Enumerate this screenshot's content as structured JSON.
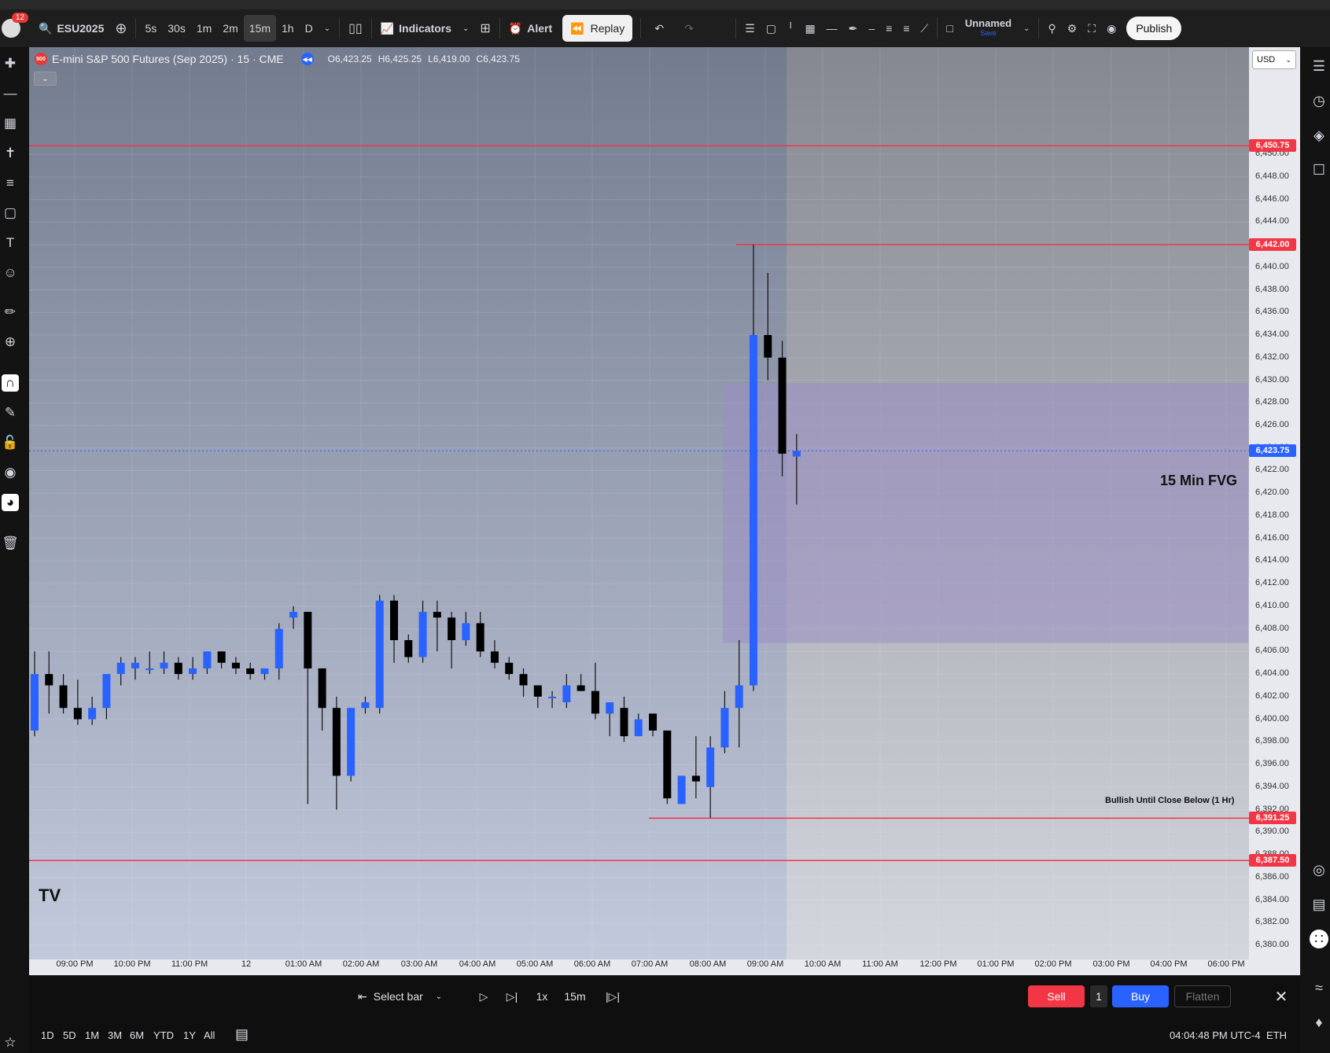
{
  "header": {
    "symbol": "ESU2025",
    "notification_count": "12",
    "intervals": [
      "5s",
      "30s",
      "1m",
      "2m",
      "15m",
      "1h",
      "D"
    ],
    "active_interval": "15m",
    "indicators_label": "Indicators",
    "alert_label": "Alert",
    "replay_label": "Replay",
    "layout_name": "Unnamed",
    "save_label": "Save",
    "publish_label": "Publish"
  },
  "legend": {
    "title": "E-mini S&P 500 Futures (Sep 2025) · 15 · CME",
    "logo_text": "500",
    "open": "O6,423.25",
    "high": "H6,425.25",
    "low": "L6,419.00",
    "close": "C6,423.75"
  },
  "currency": "USD",
  "price_axis": {
    "ticks": [
      "6,450.00",
      "6,448.00",
      "6,446.00",
      "6,444.00",
      "6,442.00",
      "6,440.00",
      "6,438.00",
      "6,436.00",
      "6,434.00",
      "6,432.00",
      "6,430.00",
      "6,428.00",
      "6,426.00",
      "6,424.00",
      "6,422.00",
      "6,420.00",
      "6,418.00",
      "6,416.00",
      "6,414.00",
      "6,412.00",
      "6,410.00",
      "6,408.00",
      "6,406.00",
      "6,404.00",
      "6,402.00",
      "6,400.00",
      "6,398.00",
      "6,396.00",
      "6,394.00",
      "6,392.00",
      "6,390.00",
      "6,388.00",
      "6,386.00",
      "6,384.00",
      "6,382.00",
      "6,380.00"
    ]
  },
  "time_axis": {
    "ticks": [
      "09:00 PM",
      "10:00 PM",
      "11:00 PM",
      "12",
      "01:00 AM",
      "02:00 AM",
      "03:00 AM",
      "04:00 AM",
      "05:00 AM",
      "06:00 AM",
      "07:00 AM",
      "08:00 AM",
      "09:00 AM",
      "10:00 AM",
      "11:00 AM",
      "12:00 PM",
      "01:00 PM",
      "02:00 PM",
      "03:00 PM",
      "04:00 PM",
      "06:00 PM"
    ]
  },
  "levels": [
    {
      "price": 6450.75,
      "label": "6,450.75",
      "color": "#f23645"
    },
    {
      "price": 6442.0,
      "label": "6,442.00",
      "color": "#f23645"
    },
    {
      "price": 6391.25,
      "label": "6,391.25",
      "color": "#f23645"
    },
    {
      "price": 6387.5,
      "label": "6,387.50",
      "color": "#f23645"
    },
    {
      "price": 6423.75,
      "label": "6,423.75",
      "color": "#2962ff"
    }
  ],
  "fvg": {
    "label": "15 Min FVG",
    "top": 6429.75,
    "bottom": 6406.75,
    "color": "#9b8ec4"
  },
  "support_note": "Bullish Until Close Below (1 Hr)",
  "chart_data": {
    "type": "candlestick",
    "interval": "15",
    "up_color": "#2962ff",
    "down_color": "#000000",
    "candles": [
      {
        "o": 6399,
        "h": 6406,
        "l": 6398.5,
        "c": 6404
      },
      {
        "o": 6404,
        "h": 6406,
        "l": 6400.5,
        "c": 6403
      },
      {
        "o": 6403,
        "h": 6404,
        "l": 6400.5,
        "c": 6401
      },
      {
        "o": 6401,
        "h": 6403.5,
        "l": 6399.5,
        "c": 6400
      },
      {
        "o": 6400,
        "h": 6402,
        "l": 6399.5,
        "c": 6401
      },
      {
        "o": 6401,
        "h": 6404,
        "l": 6400,
        "c": 6404
      },
      {
        "o": 6404,
        "h": 6405.5,
        "l": 6403,
        "c": 6405
      },
      {
        "o": 6404.5,
        "h": 6405.5,
        "l": 6403.5,
        "c": 6405
      },
      {
        "o": 6404.5,
        "h": 6406,
        "l": 6404,
        "c": 6404.5
      },
      {
        "o": 6404.5,
        "h": 6406,
        "l": 6404,
        "c": 6405
      },
      {
        "o": 6405,
        "h": 6405.5,
        "l": 6403.5,
        "c": 6404
      },
      {
        "o": 6404,
        "h": 6405.5,
        "l": 6403.5,
        "c": 6404.5
      },
      {
        "o": 6404.5,
        "h": 6406,
        "l": 6404,
        "c": 6406
      },
      {
        "o": 6406,
        "h": 6406,
        "l": 6404.5,
        "c": 6405
      },
      {
        "o": 6405,
        "h": 6405.5,
        "l": 6404,
        "c": 6404.5
      },
      {
        "o": 6404.5,
        "h": 6405,
        "l": 6403.5,
        "c": 6404
      },
      {
        "o": 6404,
        "h": 6404.5,
        "l": 6403.5,
        "c": 6404.5
      },
      {
        "o": 6404.5,
        "h": 6408.5,
        "l": 6403.5,
        "c": 6408
      },
      {
        "o": 6409,
        "h": 6410,
        "l": 6408,
        "c": 6409.5
      },
      {
        "o": 6409.5,
        "h": 6409.5,
        "l": 6392.5,
        "c": 6404.5
      },
      {
        "o": 6404.5,
        "h": 6404.5,
        "l": 6399,
        "c": 6401
      },
      {
        "o": 6401,
        "h": 6402,
        "l": 6392,
        "c": 6395
      },
      {
        "o": 6395,
        "h": 6401,
        "l": 6394.5,
        "c": 6401
      },
      {
        "o": 6401,
        "h": 6402,
        "l": 6400.5,
        "c": 6401.5
      },
      {
        "o": 6401,
        "h": 6411,
        "l": 6400.5,
        "c": 6410.5
      },
      {
        "o": 6410.5,
        "h": 6411,
        "l": 6405,
        "c": 6407
      },
      {
        "o": 6407,
        "h": 6407.5,
        "l": 6405,
        "c": 6405.5
      },
      {
        "o": 6405.5,
        "h": 6410.5,
        "l": 6405,
        "c": 6409.5
      },
      {
        "o": 6409.5,
        "h": 6410.5,
        "l": 6406,
        "c": 6409
      },
      {
        "o": 6409,
        "h": 6409.5,
        "l": 6404.5,
        "c": 6407
      },
      {
        "o": 6407,
        "h": 6409.5,
        "l": 6406.5,
        "c": 6408.5
      },
      {
        "o": 6408.5,
        "h": 6409.5,
        "l": 6405.5,
        "c": 6406
      },
      {
        "o": 6406,
        "h": 6407,
        "l": 6404.5,
        "c": 6405
      },
      {
        "o": 6405,
        "h": 6405.5,
        "l": 6403.5,
        "c": 6404
      },
      {
        "o": 6404,
        "h": 6404.5,
        "l": 6402,
        "c": 6403
      },
      {
        "o": 6403,
        "h": 6403,
        "l": 6401,
        "c": 6402
      },
      {
        "o": 6402,
        "h": 6402.5,
        "l": 6401,
        "c": 6402
      },
      {
        "o": 6401.5,
        "h": 6404,
        "l": 6401,
        "c": 6403
      },
      {
        "o": 6403,
        "h": 6404,
        "l": 6402.5,
        "c": 6402.5
      },
      {
        "o": 6402.5,
        "h": 6405,
        "l": 6400,
        "c": 6400.5
      },
      {
        "o": 6400.5,
        "h": 6401.5,
        "l": 6398.5,
        "c": 6401.5
      },
      {
        "o": 6401,
        "h": 6402,
        "l": 6398,
        "c": 6398.5
      },
      {
        "o": 6398.5,
        "h": 6400.5,
        "l": 6398.5,
        "c": 6400
      },
      {
        "o": 6400.5,
        "h": 6400.5,
        "l": 6398.5,
        "c": 6399
      },
      {
        "o": 6399,
        "h": 6399,
        "l": 6392.5,
        "c": 6393
      },
      {
        "o": 6392.5,
        "h": 6395,
        "l": 6392.5,
        "c": 6395
      },
      {
        "o": 6395,
        "h": 6398.5,
        "l": 6393,
        "c": 6394.5
      },
      {
        "o": 6394,
        "h": 6398.5,
        "l": 6391.25,
        "c": 6397.5
      },
      {
        "o": 6397.5,
        "h": 6402.5,
        "l": 6397,
        "c": 6401
      },
      {
        "o": 6401,
        "h": 6407,
        "l": 6397.5,
        "c": 6403
      },
      {
        "o": 6403,
        "h": 6442,
        "l": 6402.5,
        "c": 6434
      },
      {
        "o": 6434,
        "h": 6439.5,
        "l": 6430,
        "c": 6432
      },
      {
        "o": 6432,
        "h": 6433.5,
        "l": 6421.5,
        "c": 6423.5
      },
      {
        "o": 6423.25,
        "h": 6425.25,
        "l": 6419,
        "c": 6423.75
      }
    ]
  },
  "replay": {
    "select_bar": "Select bar",
    "speed": "1x",
    "interval": "15m",
    "sell": "Sell",
    "qty": "1",
    "buy": "Buy",
    "flatten": "Flatten"
  },
  "range_tabs": [
    "1D",
    "5D",
    "1M",
    "3M",
    "6M",
    "YTD",
    "1Y",
    "All"
  ],
  "status": {
    "time": "04:04:48 PM UTC-4",
    "session": "ETH"
  }
}
